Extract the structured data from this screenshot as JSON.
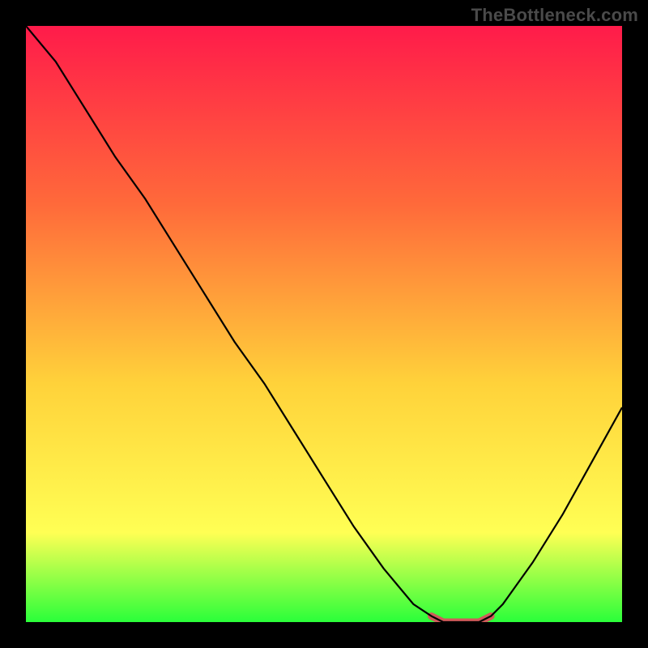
{
  "watermark": "TheBottleneck.com",
  "colors": {
    "frame": "#000000",
    "gradient_top": "#ff1b4a",
    "gradient_mid_upper": "#ff6a3a",
    "gradient_mid": "#ffd23a",
    "gradient_mid_lower": "#ffff54",
    "gradient_bottom": "#2aff3a",
    "curve": "#000000",
    "accent": "#d05a5a"
  },
  "chart_data": {
    "type": "line",
    "title": "",
    "x": [
      0.0,
      0.05,
      0.1,
      0.15,
      0.2,
      0.25,
      0.3,
      0.35,
      0.4,
      0.45,
      0.5,
      0.55,
      0.6,
      0.65,
      0.68,
      0.7,
      0.72,
      0.74,
      0.76,
      0.78,
      0.8,
      0.85,
      0.9,
      0.95,
      1.0
    ],
    "y": [
      1.0,
      0.94,
      0.86,
      0.78,
      0.71,
      0.63,
      0.55,
      0.47,
      0.4,
      0.32,
      0.24,
      0.16,
      0.09,
      0.03,
      0.01,
      0.0,
      0.0,
      0.0,
      0.0,
      0.01,
      0.03,
      0.1,
      0.18,
      0.27,
      0.36
    ],
    "accent_range_x": [
      0.67,
      0.79
    ],
    "xlim": [
      0,
      1
    ],
    "ylim": [
      0,
      1
    ],
    "xlabel": "",
    "ylabel": "",
    "grid": false,
    "legend": false
  }
}
